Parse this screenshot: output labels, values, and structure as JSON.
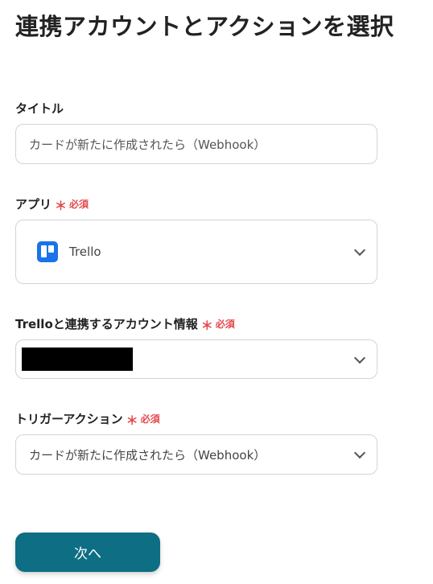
{
  "page": {
    "title": "連携アカウントとアクションを選択"
  },
  "required_label": "必須",
  "required_mark": "＊",
  "title_field": {
    "label": "タイトル",
    "value": "カードが新たに作成されたら（Webhook）"
  },
  "app_field": {
    "label": "アプリ",
    "selected": "Trello",
    "icon": "trello-logo-icon"
  },
  "account_field": {
    "label": "Trelloと連携するアカウント情報"
  },
  "trigger_field": {
    "label": "トリガーアクション",
    "selected": "カードが新たに作成されたら（Webhook）"
  },
  "next_button": {
    "label": "次へ"
  },
  "colors": {
    "accent": "#0e6e84",
    "required": "#e5484d",
    "trello": "#1a73e8",
    "border": "#d0d4d9"
  }
}
